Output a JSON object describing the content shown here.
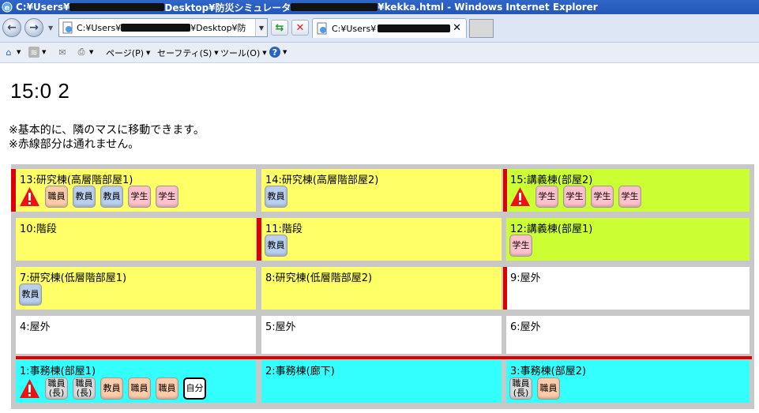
{
  "browser": {
    "title_prefix": "C:¥Users¥",
    "title_mid": "Desktop¥防災シミュレータ",
    "title_suffix": "¥kekka.html - Windows Internet Explorer",
    "address_prefix": "C:¥Users¥",
    "address_mid": "¥Desktop¥防",
    "tab_label": "C:¥Users¥",
    "tab_close": "✕",
    "menu": {
      "page": "ページ(P)",
      "safety": "セーフティ(S)",
      "tools": "ツール(O)"
    }
  },
  "page": {
    "time": "15:0 2",
    "notes": [
      "※基本的に、隣のマスに移動できます。",
      "※赤線部分は通れません。"
    ]
  },
  "colors": {
    "yellow": "#ffff66",
    "green": "#ccff33",
    "cyan": "#33ffff",
    "white": "#ffffff",
    "wall": "#dd0000",
    "staff": "#ffccaa",
    "teacher": "#b8cfee",
    "student": "#ffc2cc",
    "self": "#ffffff"
  },
  "grid": {
    "cells": [
      {
        "label": "13:研究棟(高層階部屋1)",
        "color": "yellow",
        "warning": true,
        "people": [
          {
            "text": "職員",
            "type": "staff"
          },
          {
            "text": "教員",
            "type": "teacher"
          },
          {
            "text": "教員",
            "type": "teacher"
          },
          {
            "text": "学生",
            "type": "student"
          },
          {
            "text": "学生",
            "type": "student"
          }
        ]
      },
      {
        "label": "14:研究棟(高層階部屋2)",
        "color": "yellow",
        "warning": false,
        "people": [
          {
            "text": "教員",
            "type": "teacher"
          }
        ]
      },
      {
        "label": "15:講義棟(部屋2)",
        "color": "green",
        "warning": true,
        "people": [
          {
            "text": "学生",
            "type": "student"
          },
          {
            "text": "学生",
            "type": "student"
          },
          {
            "text": "学生",
            "type": "student"
          },
          {
            "text": "学生",
            "type": "student"
          }
        ]
      },
      {
        "label": "10:階段",
        "color": "yellow",
        "warning": false,
        "people": []
      },
      {
        "label": "11:階段",
        "color": "yellow",
        "warning": false,
        "people": [
          {
            "text": "教員",
            "type": "teacher"
          }
        ]
      },
      {
        "label": "12:講義棟(部屋1)",
        "color": "green",
        "warning": false,
        "people": [
          {
            "text": "学生",
            "type": "student"
          }
        ]
      },
      {
        "label": "7:研究棟(低層階部屋1)",
        "color": "yellow",
        "warning": false,
        "people": [
          {
            "text": "教員",
            "type": "teacher"
          }
        ]
      },
      {
        "label": "8:研究棟(低層階部屋2)",
        "color": "yellow",
        "warning": false,
        "people": []
      },
      {
        "label": "9:屋外",
        "color": "white",
        "warning": false,
        "people": []
      },
      {
        "label": "4:屋外",
        "color": "white",
        "warning": false,
        "people": []
      },
      {
        "label": "5:屋外",
        "color": "white",
        "warning": false,
        "people": []
      },
      {
        "label": "6:屋外",
        "color": "white",
        "warning": false,
        "people": []
      },
      {
        "label": "1:事務棟(部屋1)",
        "color": "cyan",
        "warning": true,
        "people": [
          {
            "text": "職員\n(長)",
            "type": "chief"
          },
          {
            "text": "職員\n(長)",
            "type": "chief"
          },
          {
            "text": "教員",
            "type": "staff"
          },
          {
            "text": "職員",
            "type": "staff"
          },
          {
            "text": "職員",
            "type": "staff"
          },
          {
            "text": "自分",
            "type": "self"
          }
        ]
      },
      {
        "label": "2:事務棟(廊下)",
        "color": "cyan",
        "warning": false,
        "people": []
      },
      {
        "label": "3:事務棟(部屋2)",
        "color": "cyan",
        "warning": false,
        "people": [
          {
            "text": "職員\n(長)",
            "type": "chief"
          },
          {
            "text": "職員",
            "type": "staff"
          }
        ]
      }
    ]
  }
}
